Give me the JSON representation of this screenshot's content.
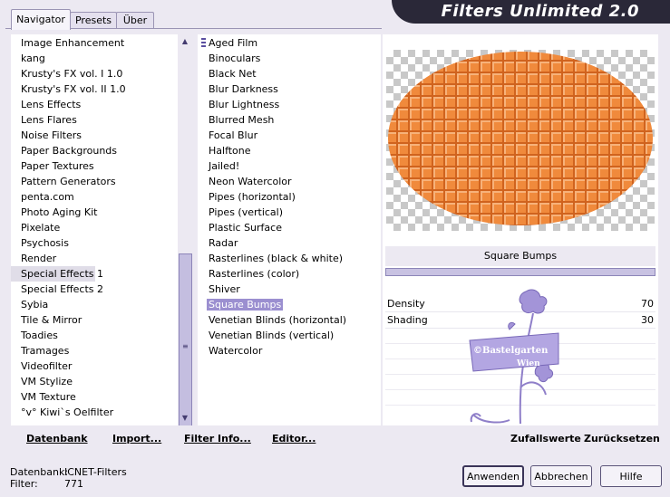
{
  "header": {
    "title": "Filters Unlimited 2.0"
  },
  "tabs": [
    {
      "label": "Navigator",
      "active": true
    },
    {
      "label": "Presets",
      "active": false
    },
    {
      "label": "Über",
      "active": false
    }
  ],
  "categories": [
    "Image Enhancement",
    "kang",
    "Krusty's FX vol. I 1.0",
    "Krusty's FX vol. II 1.0",
    "Lens Effects",
    "Lens Flares",
    "Noise Filters",
    "Paper Backgrounds",
    "Paper Textures",
    "Pattern Generators",
    "penta.com",
    "Photo Aging Kit",
    "Pixelate",
    "Psychosis",
    "Render",
    "Special Effects 1",
    "Special Effects 2",
    "Sybia",
    "Tile & Mirror",
    "Toadies",
    "Tramages",
    "Videofilter",
    "VM Stylize",
    "VM Texture",
    "°v° Kiwi`s Oelfilter"
  ],
  "selected_category": "Special Effects 1",
  "filters": [
    "Aged Film",
    "Binoculars",
    "Black Net",
    "Blur Darkness",
    "Blur Lightness",
    "Blurred Mesh",
    "Focal Blur",
    "Halftone",
    "Jailed!",
    "Neon Watercolor",
    "Pipes (horizontal)",
    "Pipes (vertical)",
    "Plastic Surface",
    "Radar",
    "Rasterlines (black & white)",
    "Rasterlines (color)",
    "Shiver",
    "Square Bumps",
    "Venetian Blinds (horizontal)",
    "Venetian Blinds (vertical)",
    "Watercolor"
  ],
  "selected_filter": "Square Bumps",
  "bottom_links": {
    "datenbank": "Datenbank",
    "import": "Import...",
    "filter_info": "Filter Info...",
    "editor": "Editor...",
    "zufallswerte": "Zufallswerte",
    "zuruecksetzen": "Zurücksetzen"
  },
  "current_filter_name": "Square Bumps",
  "params": [
    {
      "name": "Density",
      "value": "70"
    },
    {
      "name": "Shading",
      "value": "30"
    }
  ],
  "watermark": {
    "text": "©Bastelgarten Wien"
  },
  "status": {
    "datenbank_label": "Datenbank:",
    "datenbank_value": "ICNET-Filters",
    "filter_label": "Filter:",
    "filter_value": "771"
  },
  "buttons": {
    "anwenden": "Anwenden",
    "abbrechen": "Abbrechen",
    "hilfe": "Hilfe"
  },
  "colors": {
    "accent": "#9b8fd0",
    "header": "#2a2838",
    "preview_orange": "#f08a3c"
  }
}
